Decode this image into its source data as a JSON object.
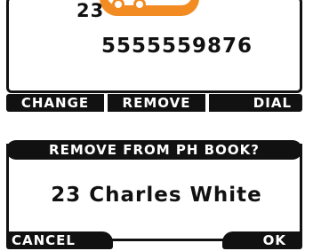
{
  "screen1": {
    "entry_index": "23",
    "phone_number": "5555559876",
    "softkeys": {
      "change": "CHANGE",
      "remove": "REMOVE",
      "dial": "DIAL"
    },
    "accent_color": "#f28c22"
  },
  "screen2": {
    "title": "REMOVE FROM PH BOOK?",
    "contact": "23 Charles White",
    "softkeys": {
      "cancel": "CANCEL",
      "ok": "OK"
    }
  }
}
